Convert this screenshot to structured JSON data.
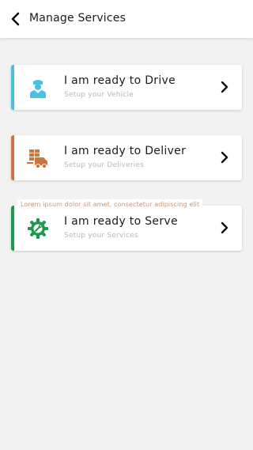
{
  "header": {
    "title": "Manage Services",
    "back_icon": "chevron-left-icon"
  },
  "services": [
    {
      "title": "I am ready to Drive",
      "subtitle": "Setup your Vehicle",
      "accent": "#4bbfe6",
      "icon": "driver-icon",
      "icon_color": "#4bbfe6"
    },
    {
      "title": "I am ready to Deliver",
      "subtitle": "Setup your Deliveries",
      "accent": "#c9773f",
      "icon": "delivery-truck-icon",
      "icon_color": "#c9773f"
    },
    {
      "title": "I am ready to Serve",
      "subtitle": "Setup your Services",
      "accent": "#1a9a4a",
      "icon": "gear-wrench-icon",
      "icon_color": "#1a9a4a"
    }
  ],
  "tooltip": "Lorem ipsum dolor sit amet, consectetur adipiscing elit",
  "colors": {
    "background": "#f2f2f2",
    "card": "#ffffff",
    "text": "#1b1b1b",
    "muted": "#b9b9b9",
    "tooltip_text": "#c7977a"
  }
}
